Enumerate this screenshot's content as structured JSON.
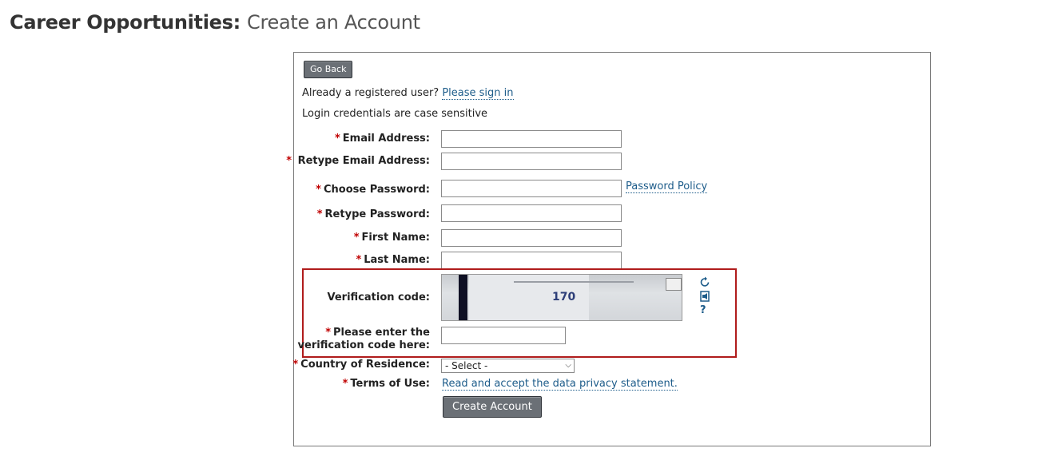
{
  "header": {
    "title_main": "Career Opportunities:",
    "title_sub": "Create an Account"
  },
  "form": {
    "go_back": "Go Back",
    "registered_prefix": "Already a registered user?",
    "sign_in_link": "Please sign in",
    "case_note": "Login credentials are case sensitive",
    "required_mark": "*",
    "fields": {
      "email": {
        "label": "Email Address:",
        "value": ""
      },
      "retype_email": {
        "label": "Retype Email Address:",
        "value": ""
      },
      "password": {
        "label": "Choose Password:",
        "value": ""
      },
      "retype_password": {
        "label": "Retype Password:",
        "value": ""
      },
      "first_name": {
        "label": "First Name:",
        "value": ""
      },
      "last_name": {
        "label": "Last Name:",
        "value": ""
      }
    },
    "password_policy": "Password Policy",
    "verification": {
      "label": "Verification code:",
      "captcha_text": "170",
      "enter_label_1": "Please enter the",
      "enter_label_2": "verification code here:",
      "value": "",
      "icons": [
        "refresh-icon",
        "audio-icon",
        "help-icon"
      ],
      "help_glyph": "?"
    },
    "country": {
      "label": "Country of Residence:",
      "selected": "- Select -"
    },
    "terms": {
      "label": "Terms of Use:",
      "link": "Read and accept the data privacy statement."
    },
    "create_button": "Create Account"
  },
  "colors": {
    "required": "#c00000",
    "link": "#1d5c8a",
    "button": "#6b7076",
    "highlight_border": "#b01c1c"
  }
}
